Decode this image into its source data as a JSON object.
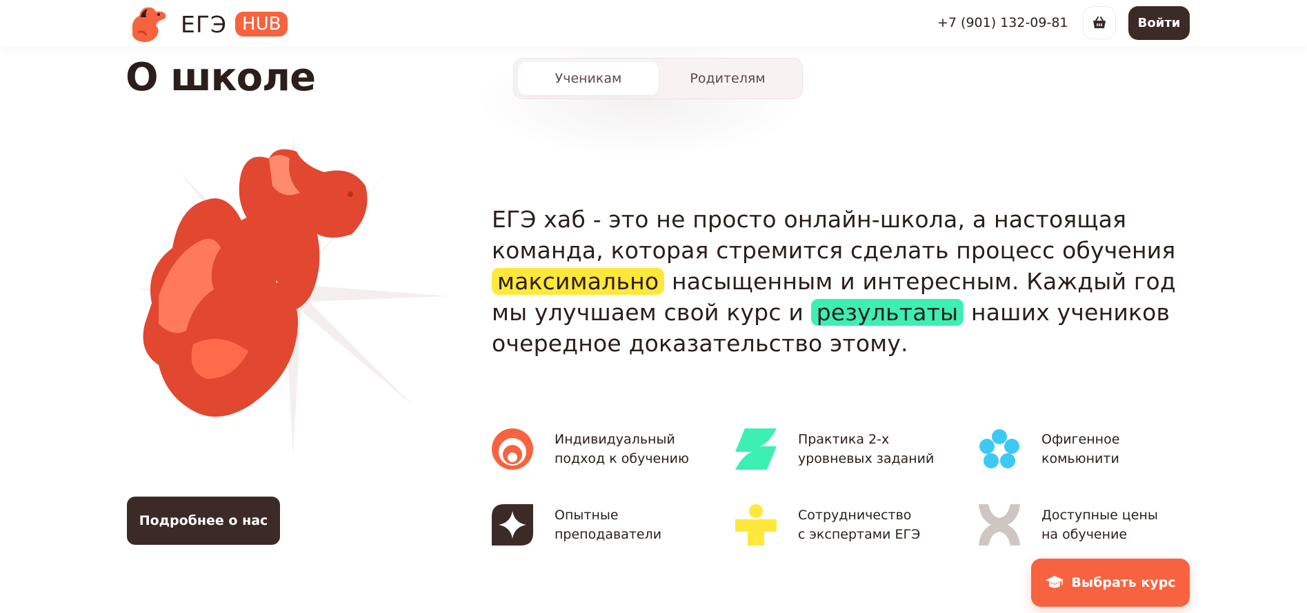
{
  "header": {
    "logo_text": "ЕГЭ",
    "logo_badge": "HUB",
    "phone": "+7 (901) 132-09-81",
    "cart_icon": "basket-icon",
    "login_label": "Войти"
  },
  "page": {
    "title": "О школе",
    "tabs": [
      {
        "label": "Ученикам",
        "active": true
      },
      {
        "label": "Родителям",
        "active": false
      }
    ]
  },
  "hero": {
    "text_part1": "ЕГЭ хаб - это не просто онлайн-школа, а настоящая команда, которая стремится сделать процесс обучения ",
    "highlight1": "максимально",
    "text_part2": " насыщенным и интересным. Каждый год мы улучшаем свой курс и ",
    "highlight2": "результаты",
    "text_part3": " наших учеников очередное доказательство этому.",
    "highlight_colors": {
      "yellow": "#ffe83a",
      "green": "#3cf0b4"
    }
  },
  "features": [
    {
      "icon": "target-circles-icon",
      "line1": "Индивидуальный",
      "line2": "подход к обучению"
    },
    {
      "icon": "green-z-icon",
      "line1": "Практика 2-х",
      "line2": "уровневых заданий"
    },
    {
      "icon": "blue-flower-icon",
      "line1": "Офигенное",
      "line2": "комьюнити"
    },
    {
      "icon": "sparkle-icon",
      "line1": "Опытные",
      "line2": "преподаватели"
    },
    {
      "icon": "yellow-person-icon",
      "line1": "Сотрудничество",
      "line2": "с экспертами ЕГЭ"
    },
    {
      "icon": "gray-x-shape-icon",
      "line1": "Доступные цены",
      "line2": "на обучение"
    }
  ],
  "buttons": {
    "more_label": "Подробнее о нас",
    "choose_label": "Выбрать курс",
    "choose_icon": "graduation-cap-icon"
  },
  "colors": {
    "accent": "#f7633f",
    "dark": "#3b2a26"
  }
}
